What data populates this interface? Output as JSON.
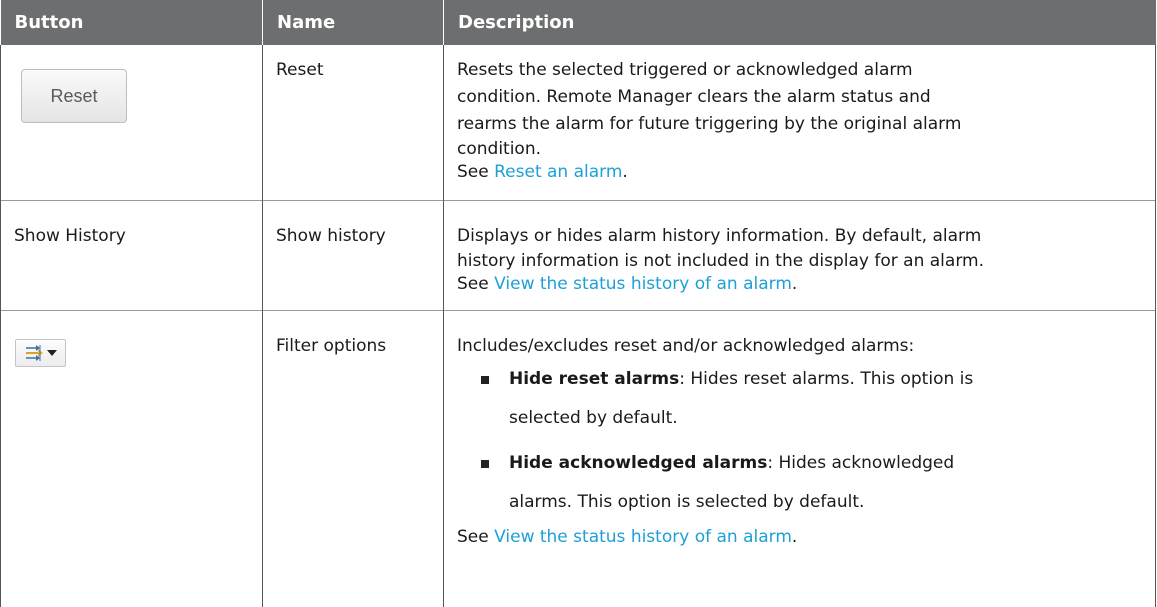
{
  "header": {
    "col_button": "Button",
    "col_name": "Name",
    "col_description": "Description"
  },
  "rows": [
    {
      "button_label": "Reset",
      "name": "Reset",
      "description_lines": [
        "Resets the selected triggered or acknowledged alarm",
        "condition. Remote Manager clears the alarm status and",
        "rearms the alarm for future triggering by the original alarm",
        "condition."
      ],
      "see_prefix": "See ",
      "see_link": "Reset an alarm",
      "see_suffix": "."
    },
    {
      "button_label": "Show History",
      "name": "Show history",
      "description_lines": [
        "Displays or hides alarm history information. By default, alarm",
        "history information is not included in the display for an alarm."
      ],
      "see_prefix": "See ",
      "see_link": "View the status history of an alarm",
      "see_suffix": "."
    },
    {
      "button_icon": "filter-options-icon",
      "name": "Filter options",
      "intro": "Includes/excludes reset and/or acknowledged alarms:",
      "options": [
        {
          "term": "Hide reset alarms",
          "text": ": Hides reset alarms. This option is",
          "text2": "selected by default."
        },
        {
          "term": "Hide acknowledged alarms",
          "text": ": Hides acknowledged",
          "text2": "alarms. This option is selected by default."
        }
      ],
      "see_prefix": "See ",
      "see_link": "View the status history of an alarm",
      "see_suffix": "."
    }
  ],
  "colors": {
    "header_bg": "#6d6e70",
    "link": "#1e9fd6"
  }
}
